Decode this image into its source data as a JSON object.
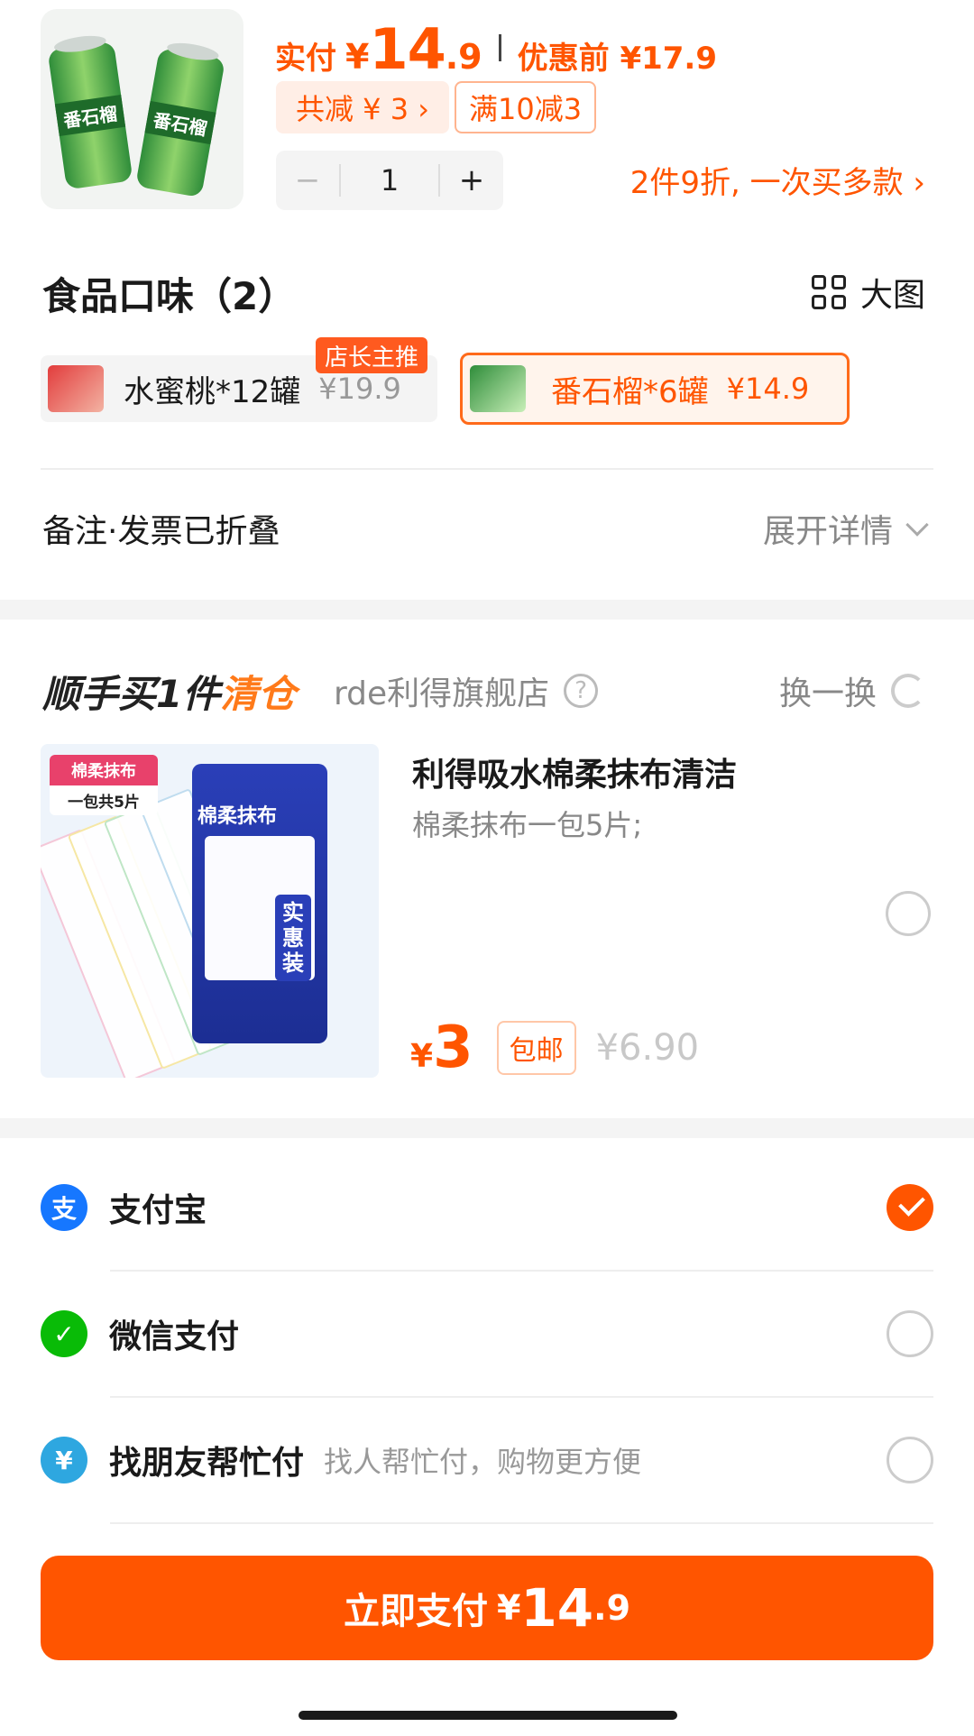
{
  "product": {
    "paid_label": "实付",
    "currency": "¥",
    "price_int": "14",
    "price_dec": ".9",
    "orig_label": "优惠前 ¥17.9",
    "save_tag": "共减 ¥ 3 ›",
    "full_reduction_tag": "满10减3",
    "quantity": "1",
    "minus": "−",
    "plus": "+",
    "promo_text": "2件9折, 一次买多款 ›"
  },
  "flavor": {
    "title": "食品口味（2）",
    "big_view_label": "大图",
    "owner_badge": "店长主推",
    "options": [
      {
        "name": "水蜜桃*12罐",
        "price": "¥19.9",
        "selected": false
      },
      {
        "name": "番石榴*6罐",
        "price": "¥14.9",
        "selected": true
      }
    ],
    "can_label": "番石榴"
  },
  "note": {
    "label": "备注·发票已折叠",
    "expand": "展开详情"
  },
  "addon": {
    "title_main": "顺手买1件",
    "title_hl": "清仓",
    "store": "rde利得旗舰店",
    "help": "?",
    "refresh": "换一换",
    "name": "利得吸水棉柔抹布清洁",
    "desc": "棉柔抹布一包5片;",
    "yen": "¥",
    "price": "3",
    "free_ship": "包邮",
    "orig_price": "¥6.90",
    "img_tag_1": "棉柔抹布",
    "img_tag_2": "一包共5片",
    "pack_title": "棉柔抹布",
    "pack_vert": "实惠装"
  },
  "payment": {
    "methods": [
      {
        "label": "支付宝",
        "sub": "",
        "icon": "alipay-icon",
        "color": "#1677ff",
        "glyph": "支",
        "selected": true
      },
      {
        "label": "微信支付",
        "sub": "",
        "icon": "wechat-pay-icon",
        "color": "#09bb07",
        "glyph": "✓",
        "selected": false
      },
      {
        "label": "找朋友帮忙付",
        "sub": "找人帮忙付，购物更方便",
        "icon": "friend-pay-icon",
        "color": "#2ea7e0",
        "glyph": "¥",
        "selected": false
      }
    ],
    "button_label": "立即支付",
    "button_yen": "¥",
    "button_int": "14",
    "button_dec": ".9"
  },
  "colors": {
    "accent": "#ff5500",
    "selected_border": "#ff6a1a"
  }
}
